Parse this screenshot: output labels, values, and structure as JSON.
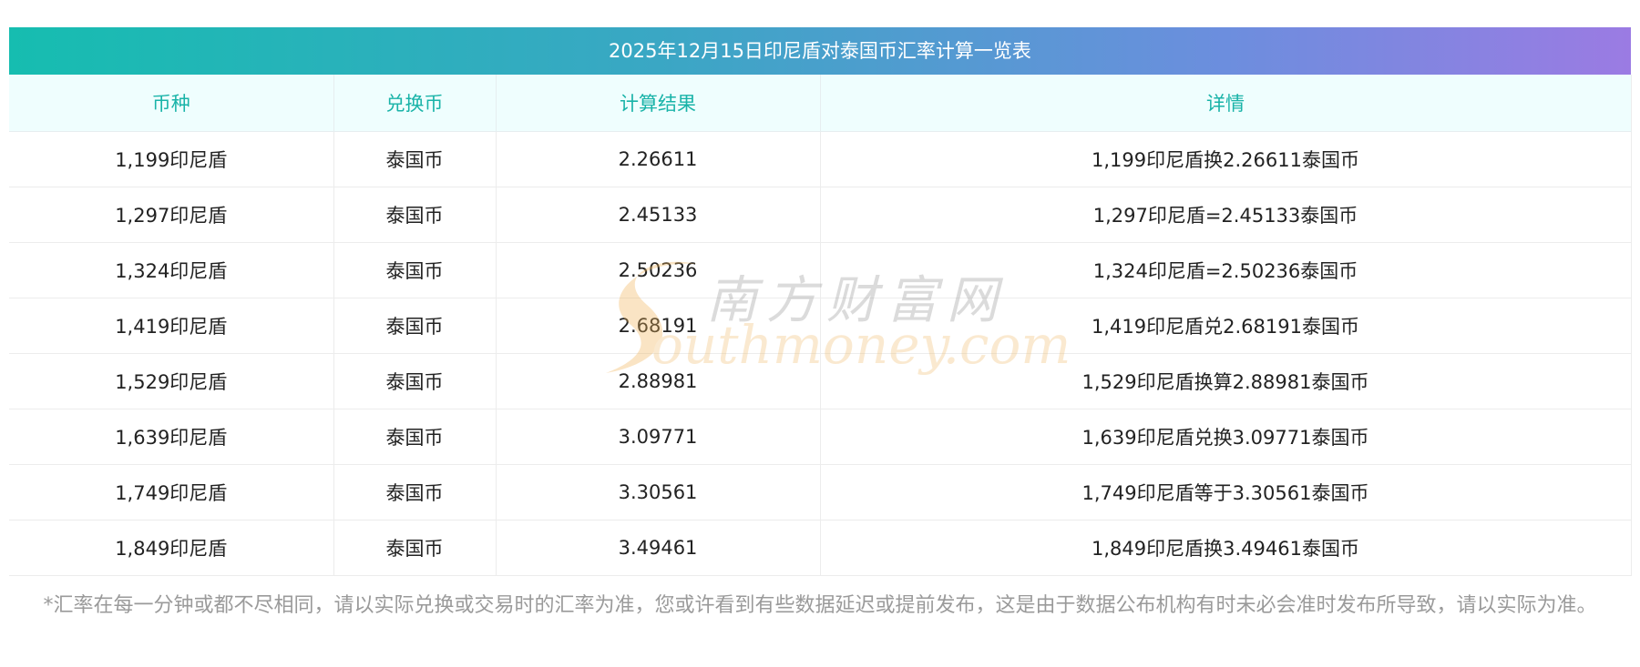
{
  "table": {
    "title": "2025年12月15日印尼盾对泰国币汇率计算一览表",
    "headers": [
      "币种",
      "兑换币",
      "计算结果",
      "详情"
    ],
    "rows": [
      {
        "currency": "1,199印尼盾",
        "target": "泰国币",
        "result": "2.26611",
        "detail": "1,199印尼盾换2.26611泰国币"
      },
      {
        "currency": "1,297印尼盾",
        "target": "泰国币",
        "result": "2.45133",
        "detail": "1,297印尼盾=2.45133泰国币"
      },
      {
        "currency": "1,324印尼盾",
        "target": "泰国币",
        "result": "2.50236",
        "detail": "1,324印尼盾=2.50236泰国币"
      },
      {
        "currency": "1,419印尼盾",
        "target": "泰国币",
        "result": "2.68191",
        "detail": "1,419印尼盾兑2.68191泰国币"
      },
      {
        "currency": "1,529印尼盾",
        "target": "泰国币",
        "result": "2.88981",
        "detail": "1,529印尼盾换算2.88981泰国币"
      },
      {
        "currency": "1,639印尼盾",
        "target": "泰国币",
        "result": "3.09771",
        "detail": "1,639印尼盾兑换3.09771泰国币"
      },
      {
        "currency": "1,749印尼盾",
        "target": "泰国币",
        "result": "3.30561",
        "detail": "1,749印尼盾等于3.30561泰国币"
      },
      {
        "currency": "1,849印尼盾",
        "target": "泰国币",
        "result": "3.49461",
        "detail": "1,849印尼盾换3.49461泰国币"
      }
    ]
  },
  "footnote": "*汇率在每一分钟或都不尽相同，请以实际兑换或交易时的汇率为准，您或许看到有些数据延迟或提前发布，这是由于数据公布机构有时未必会准时发布所导致，请以实际为准。",
  "watermark": {
    "cn": "南方财富网",
    "en": "outhmoney.com"
  },
  "colors": {
    "header_text": "#19b3a8",
    "title_gradient_start": "#16bdb0",
    "title_gradient_end": "#9b7be3"
  }
}
